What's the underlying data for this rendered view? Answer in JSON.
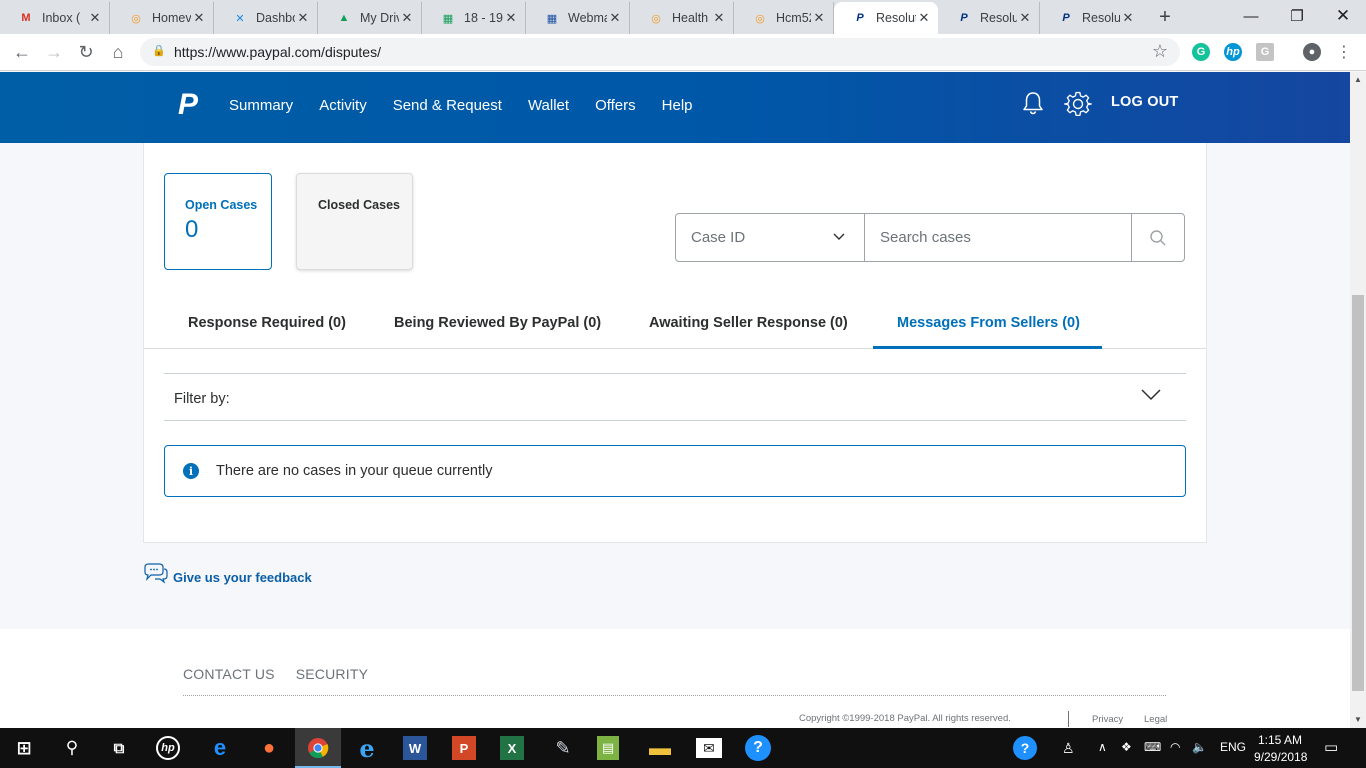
{
  "browser": {
    "tabs": [
      {
        "title": "Inbox (",
        "favicon": "gmail-icon",
        "color": "#d93025",
        "glyph": "M"
      },
      {
        "title": "Homev",
        "favicon": "orange-circle-icon",
        "color": "#f59a23",
        "glyph": "◎"
      },
      {
        "title": "Dashbo",
        "favicon": "x-app-icon",
        "color": "#1e88e5",
        "glyph": "✕"
      },
      {
        "title": "My Driv",
        "favicon": "google-drive-icon",
        "color": "#0f9d58",
        "glyph": "▲"
      },
      {
        "title": "18 - 19",
        "favicon": "google-sheets-icon",
        "color": "#0f9d58",
        "glyph": "▦"
      },
      {
        "title": "Webma",
        "favicon": "grid-app-icon",
        "color": "#1a4fa0",
        "glyph": "▦"
      },
      {
        "title": "Health",
        "favicon": "orange-circle-icon",
        "color": "#f59a23",
        "glyph": "◎"
      },
      {
        "title": "Hcm52",
        "favicon": "orange-circle-icon",
        "color": "#f59a23",
        "glyph": "◎"
      },
      {
        "title": "Resolut",
        "favicon": "paypal-icon",
        "color": "#003087",
        "glyph": "P"
      },
      {
        "title": "Resolut",
        "favicon": "paypal-icon",
        "color": "#003087",
        "glyph": "P"
      },
      {
        "title": "Resolut",
        "favicon": "paypal-icon",
        "color": "#003087",
        "glyph": "P"
      }
    ],
    "active_tab_index": 8,
    "url": "https://www.paypal.com/disputes/"
  },
  "paypal": {
    "nav": [
      "Summary",
      "Activity",
      "Send & Request",
      "Wallet",
      "Offers",
      "Help"
    ],
    "logout": "LOG OUT",
    "brand_color": "#0070ba"
  },
  "cases": {
    "open_label": "Open Cases",
    "open_count": "0",
    "closed_label": "Closed Cases"
  },
  "search": {
    "type_selected": "Case ID",
    "placeholder": "Search cases"
  },
  "queue_tabs": [
    "Response Required (0)",
    "Being Reviewed By PayPal (0)",
    "Awaiting Seller Response (0)",
    "Messages From Sellers (0)"
  ],
  "filter": {
    "label": "Filter by:"
  },
  "notice": {
    "text": "There are no cases in your queue currently"
  },
  "feedback": {
    "text": "Give us your feedback"
  },
  "footer": {
    "links": [
      "CONTACT US",
      "SECURITY"
    ],
    "copyright": "Copyright ©1999-2018 PayPal. All rights reserved.",
    "privacy": "Privacy",
    "legal": "Legal"
  },
  "taskbar": {
    "language": "ENG",
    "time": "1:15 AM",
    "date": "9/29/2018"
  }
}
